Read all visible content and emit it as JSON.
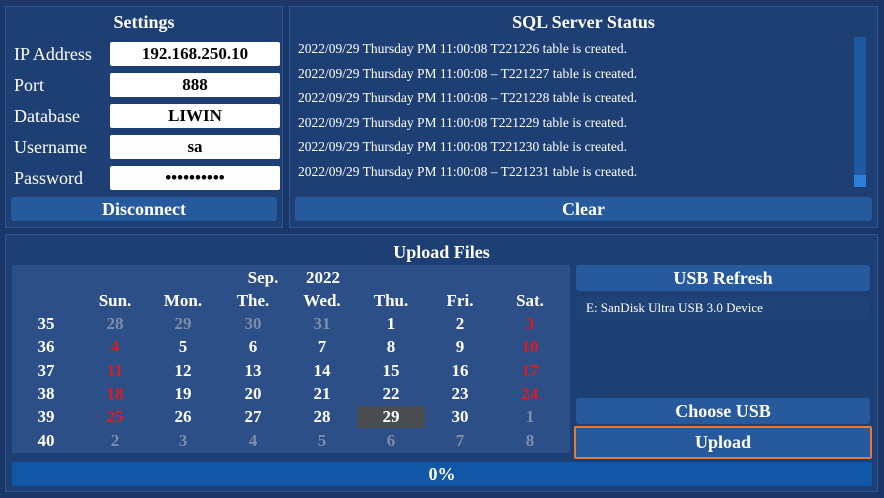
{
  "settings": {
    "title": "Settings",
    "fields": [
      {
        "label": "IP Address",
        "value": "192.168.250.10",
        "type": "text"
      },
      {
        "label": "Port",
        "value": "888",
        "type": "text"
      },
      {
        "label": "Database",
        "value": "LIWIN",
        "type": "text"
      },
      {
        "label": "Username",
        "value": "sa",
        "type": "text"
      },
      {
        "label": "Password",
        "value": "••••••••••",
        "type": "password"
      }
    ],
    "disconnect_label": "Disconnect"
  },
  "sql_status": {
    "title": "SQL Server Status",
    "log": [
      "2022/09/29 Thursday PM 11:00:08   T221226 table is created.",
      "2022/09/29 Thursday PM 11:00:08 – T221227 table is created.",
      "2022/09/29 Thursday PM 11:00:08 – T221228 table is created.",
      "2022/09/29 Thursday PM 11:00:08   T221229 table is created.",
      "2022/09/29 Thursday PM 11:00:08   T221230 table is created.",
      "2022/09/29 Thursday PM 11:00:08 – T221231 table is created."
    ],
    "clear_label": "Clear"
  },
  "upload": {
    "title": "Upload Files",
    "calendar": {
      "month": "Sep.",
      "year": "2022",
      "weekdays": [
        "Sun.",
        "Mon.",
        "The.",
        "Wed.",
        "Thu.",
        "Fri.",
        "Sat."
      ],
      "weeks": [
        {
          "week": "35",
          "days": [
            {
              "d": "28",
              "s": "dim"
            },
            {
              "d": "29",
              "s": "dim"
            },
            {
              "d": "30",
              "s": "dim"
            },
            {
              "d": "31",
              "s": "dim"
            },
            {
              "d": "1",
              "s": ""
            },
            {
              "d": "2",
              "s": ""
            },
            {
              "d": "3",
              "s": "red"
            }
          ]
        },
        {
          "week": "36",
          "days": [
            {
              "d": "4",
              "s": "red"
            },
            {
              "d": "5",
              "s": ""
            },
            {
              "d": "6",
              "s": ""
            },
            {
              "d": "7",
              "s": ""
            },
            {
              "d": "8",
              "s": ""
            },
            {
              "d": "9",
              "s": ""
            },
            {
              "d": "10",
              "s": "red"
            }
          ]
        },
        {
          "week": "37",
          "days": [
            {
              "d": "11",
              "s": "red"
            },
            {
              "d": "12",
              "s": ""
            },
            {
              "d": "13",
              "s": ""
            },
            {
              "d": "14",
              "s": ""
            },
            {
              "d": "15",
              "s": ""
            },
            {
              "d": "16",
              "s": ""
            },
            {
              "d": "17",
              "s": "red"
            }
          ]
        },
        {
          "week": "38",
          "days": [
            {
              "d": "18",
              "s": "red"
            },
            {
              "d": "19",
              "s": ""
            },
            {
              "d": "20",
              "s": ""
            },
            {
              "d": "21",
              "s": ""
            },
            {
              "d": "22",
              "s": ""
            },
            {
              "d": "23",
              "s": ""
            },
            {
              "d": "24",
              "s": "red"
            }
          ]
        },
        {
          "week": "39",
          "days": [
            {
              "d": "25",
              "s": "red"
            },
            {
              "d": "26",
              "s": ""
            },
            {
              "d": "27",
              "s": ""
            },
            {
              "d": "28",
              "s": ""
            },
            {
              "d": "29",
              "s": "sel"
            },
            {
              "d": "30",
              "s": ""
            },
            {
              "d": "1",
              "s": "dim"
            }
          ]
        },
        {
          "week": "40",
          "days": [
            {
              "d": "2",
              "s": "dim"
            },
            {
              "d": "3",
              "s": "dim"
            },
            {
              "d": "4",
              "s": "dim"
            },
            {
              "d": "5",
              "s": "dim"
            },
            {
              "d": "6",
              "s": "dim"
            },
            {
              "d": "7",
              "s": "dim"
            },
            {
              "d": "8",
              "s": "dim"
            }
          ]
        }
      ]
    },
    "usb_refresh_label": "USB Refresh",
    "usb_devices": [
      "E: SanDisk Ultra USB 3.0 Device"
    ],
    "choose_usb_label": "Choose USB",
    "upload_label": "Upload",
    "progress": {
      "percent": 0,
      "label": "0%"
    }
  },
  "colors": {
    "background": "#1b3768",
    "button": "#27599d",
    "progress": "#1057a8",
    "weekend": "#e0191e",
    "dim": "#7f8ea8",
    "focus_border": "#e07b39"
  }
}
